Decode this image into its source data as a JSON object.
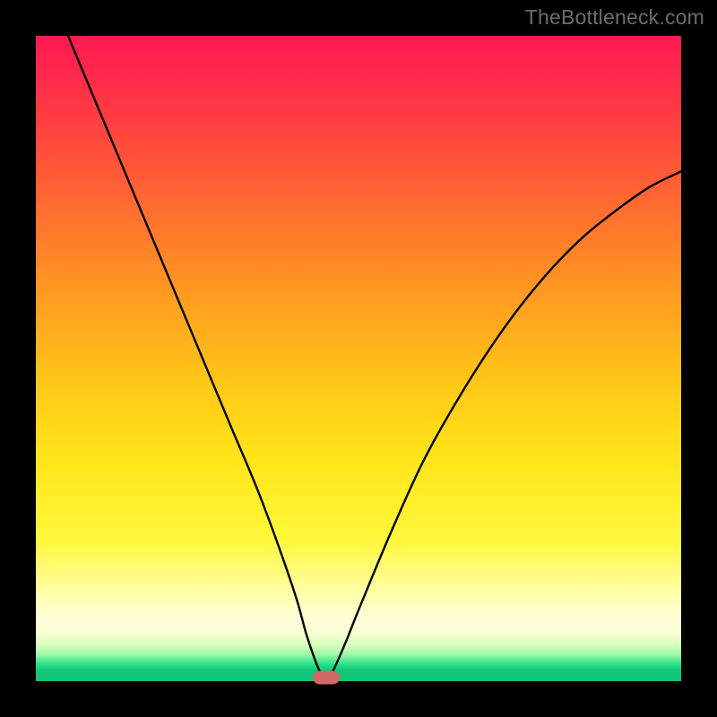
{
  "watermark": "TheBottleneck.com",
  "chart_data": {
    "type": "line",
    "title": "",
    "xlabel": "",
    "ylabel": "",
    "xlim": [
      0,
      100
    ],
    "ylim": [
      0,
      100
    ],
    "grid": false,
    "legend": false,
    "series": [
      {
        "name": "bottleneck-curve",
        "x": [
          5,
          10,
          15,
          20,
          25,
          30,
          35,
          40,
          42,
          44,
          45,
          46,
          48,
          50,
          55,
          60,
          65,
          70,
          75,
          80,
          85,
          90,
          95,
          100
        ],
        "values": [
          100,
          88,
          76,
          64,
          52,
          40,
          28,
          14,
          7,
          1.5,
          0.5,
          1.5,
          6,
          11,
          23,
          34,
          43,
          51,
          58,
          64,
          69,
          73,
          76.5,
          79
        ]
      }
    ],
    "marker": {
      "x": 45,
      "y": 0.5,
      "color": "#cf6a64"
    },
    "gradient_stops": [
      {
        "pos": 0,
        "color": "#ff1a52"
      },
      {
        "pos": 50,
        "color": "#ffd020"
      },
      {
        "pos": 80,
        "color": "#fff95a"
      },
      {
        "pos": 100,
        "color": "#12c77a"
      }
    ]
  }
}
